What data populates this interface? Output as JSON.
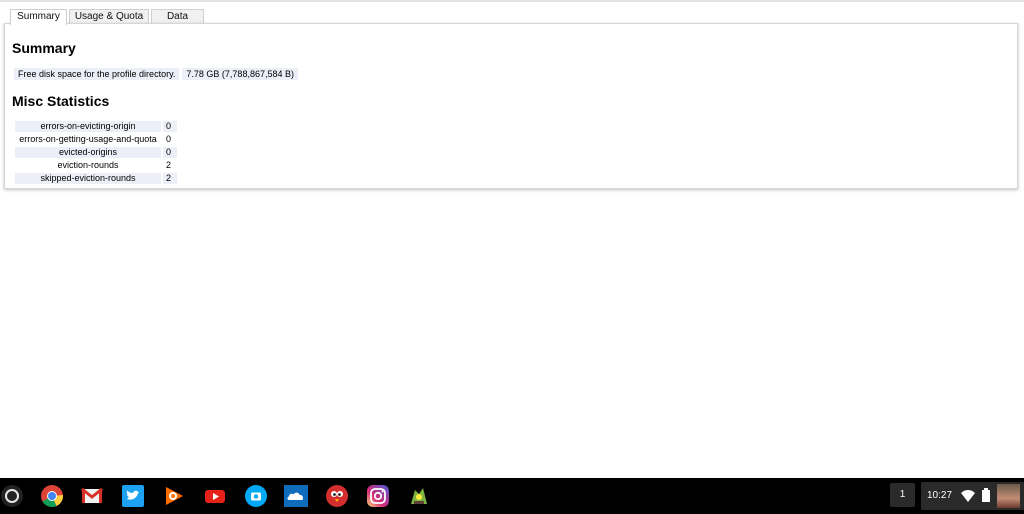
{
  "tabs": [
    {
      "label": "Summary"
    },
    {
      "label": "Usage & Quota"
    },
    {
      "label": "Data"
    }
  ],
  "summary": {
    "heading": "Summary",
    "free_space_label": "Free disk space for the profile directory.",
    "free_space_value": "7.78 GB (7,788,867,584 B)"
  },
  "misc": {
    "heading": "Misc Statistics",
    "rows": [
      {
        "key": "errors-on-evicting-origin",
        "value": "0"
      },
      {
        "key": "errors-on-getting-usage-and-quota",
        "value": "0"
      },
      {
        "key": "evicted-origins",
        "value": "0"
      },
      {
        "key": "eviction-rounds",
        "value": "2"
      },
      {
        "key": "skipped-eviction-rounds",
        "value": "2"
      }
    ]
  },
  "shelf": {
    "apps": [
      "chrome-icon",
      "gmail-icon",
      "twitter-icon",
      "play-music-icon",
      "youtube-icon",
      "camera-icon",
      "onedrive-icon",
      "angry-bird-icon",
      "instagram-icon",
      "game-icon"
    ],
    "notification_count": "1",
    "time": "10:27"
  }
}
